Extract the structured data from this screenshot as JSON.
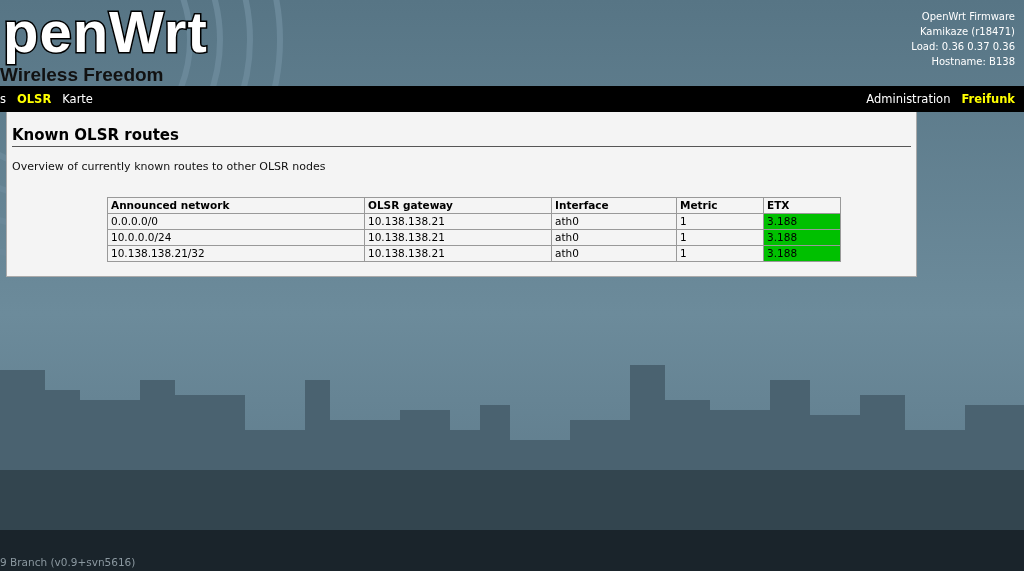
{
  "header": {
    "logo_title": "penWrt",
    "logo_subtitle": "Wireless Freedom",
    "info": [
      "OpenWrt Firmware",
      "Kamikaze (r18471)",
      "Load: 0.36 0.37 0.36",
      "Hostname: B138"
    ]
  },
  "nav": {
    "left": [
      {
        "label": "s",
        "selected": false
      },
      {
        "label": "OLSR",
        "selected": true
      },
      {
        "label": "Karte",
        "selected": false
      }
    ],
    "right": [
      {
        "label": "Administration",
        "selected": false
      },
      {
        "label": "Freifunk",
        "selected": true
      }
    ]
  },
  "content": {
    "title": "Known OLSR routes",
    "description": "Overview of currently known routes to other OLSR nodes",
    "table": {
      "columns": [
        "Announced network",
        "OLSR gateway",
        "Interface",
        "Metric",
        "ETX"
      ],
      "rows": [
        {
          "cells": [
            "0.0.0.0/0",
            "10.138.138.21",
            "ath0",
            "1",
            "3.188"
          ],
          "color": "#00c000"
        },
        {
          "cells": [
            "10.0.0.0/24",
            "10.138.138.21",
            "ath0",
            "1",
            "3.188"
          ],
          "color": "#00c000"
        },
        {
          "cells": [
            "10.138.138.21/32",
            "10.138.138.21",
            "ath0",
            "1",
            "3.188"
          ],
          "color": "#00c000"
        }
      ]
    }
  },
  "footer": "9 Branch (v0.9+svn5616)"
}
